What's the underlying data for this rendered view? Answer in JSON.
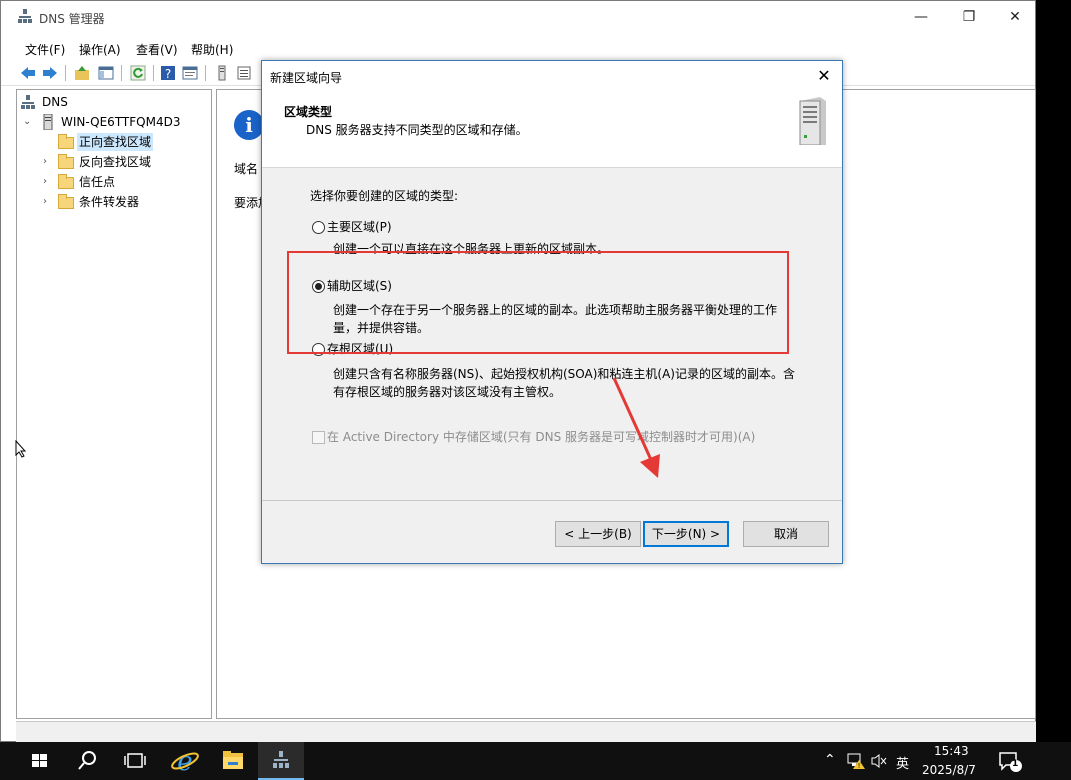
{
  "window": {
    "title": "DNS 管理器"
  },
  "menu": [
    "文件(F)",
    "操作(A)",
    "查看(V)",
    "帮助(H)"
  ],
  "tree": {
    "root": "DNS",
    "server": "WIN-QE6TTFQM4D3",
    "items": [
      "正向查找区域",
      "反向查找区域",
      "信任点",
      "条件转发器"
    ]
  },
  "right_pane": {
    "text1": "域名",
    "text2": "要添加"
  },
  "dialog": {
    "title": "新建区域向导",
    "header_title": "区域类型",
    "header_sub": "DNS 服务器支持不同类型的区域和存储。",
    "prompt": "选择你要创建的区域的类型:",
    "options": [
      {
        "label": "主要区域(P)",
        "desc": "创建一个可以直接在这个服务器上更新的区域副本。",
        "selected": false
      },
      {
        "label": "辅助区域(S)",
        "desc": "创建一个存在于另一个服务器上的区域的副本。此选项帮助主服务器平衡处理的工作量，并提供容错。",
        "selected": true
      },
      {
        "label": "存根区域(U)",
        "desc": "创建只含有名称服务器(NS)、起始授权机构(SOA)和粘连主机(A)记录的区域的副本。含有存根区域的服务器对该区域没有主管权。",
        "selected": false
      }
    ],
    "checkbox_label": "在 Active Directory 中存储区域(只有 DNS 服务器是可写域控制器时才可用)(A)",
    "buttons": {
      "back": "< 上一步(B)",
      "next": "下一步(N) >",
      "cancel": "取消"
    }
  },
  "taskbar": {
    "time": "15:43",
    "date": "2025/8/7",
    "ime": "英",
    "notification_count": "1"
  },
  "colors": {
    "highlight_box": "#e53935",
    "arrow": "#e53935",
    "selection": "#cce8ff"
  }
}
